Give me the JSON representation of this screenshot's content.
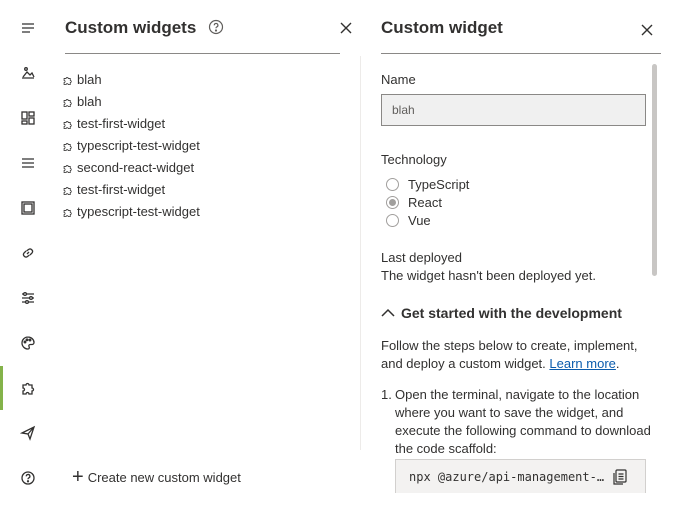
{
  "rail": {
    "items": [
      {
        "icon": "menu-icon",
        "active": false
      },
      {
        "icon": "image-icon",
        "active": false
      },
      {
        "icon": "dashboard-icon",
        "active": false
      },
      {
        "icon": "list-icon",
        "active": false
      },
      {
        "icon": "layout-icon",
        "active": false
      },
      {
        "icon": "link-icon",
        "active": false
      },
      {
        "icon": "settings-sliders-icon",
        "active": false
      },
      {
        "icon": "palette-icon",
        "active": false
      },
      {
        "icon": "puzzle-icon",
        "active": true
      },
      {
        "icon": "send-icon",
        "active": false
      },
      {
        "icon": "help-icon",
        "active": false
      }
    ],
    "accent_color": "#84b34a"
  },
  "widgets_panel": {
    "title": "Custom widgets",
    "items": [
      "blah",
      "blah",
      "test-first-widget",
      "typescript-test-widget",
      "second-react-widget",
      "test-first-widget",
      "typescript-test-widget"
    ],
    "create_label": "Create new custom widget"
  },
  "detail_panel": {
    "title": "Custom widget",
    "name_label": "Name",
    "name_value": "blah",
    "technology_label": "Technology",
    "technology_options": [
      {
        "label": "TypeScript",
        "checked": false
      },
      {
        "label": "React",
        "checked": true
      },
      {
        "label": "Vue",
        "checked": false
      }
    ],
    "last_deployed_label": "Last deployed",
    "last_deployed_value": "The widget hasn't been deployed yet.",
    "section_title": "Get started with the development",
    "intro_line1": "Follow the steps below to create, implement,",
    "intro_line2": "and deploy a custom widget.",
    "learn_more": "Learn more",
    "step1_num": "1.",
    "step1_text": "Open the terminal, navigate to the location where you want to save the widget, and execute the following command to download the code scaffold:",
    "command": "npx @azure/api-management-…",
    "link_color": "#0b5cad"
  }
}
